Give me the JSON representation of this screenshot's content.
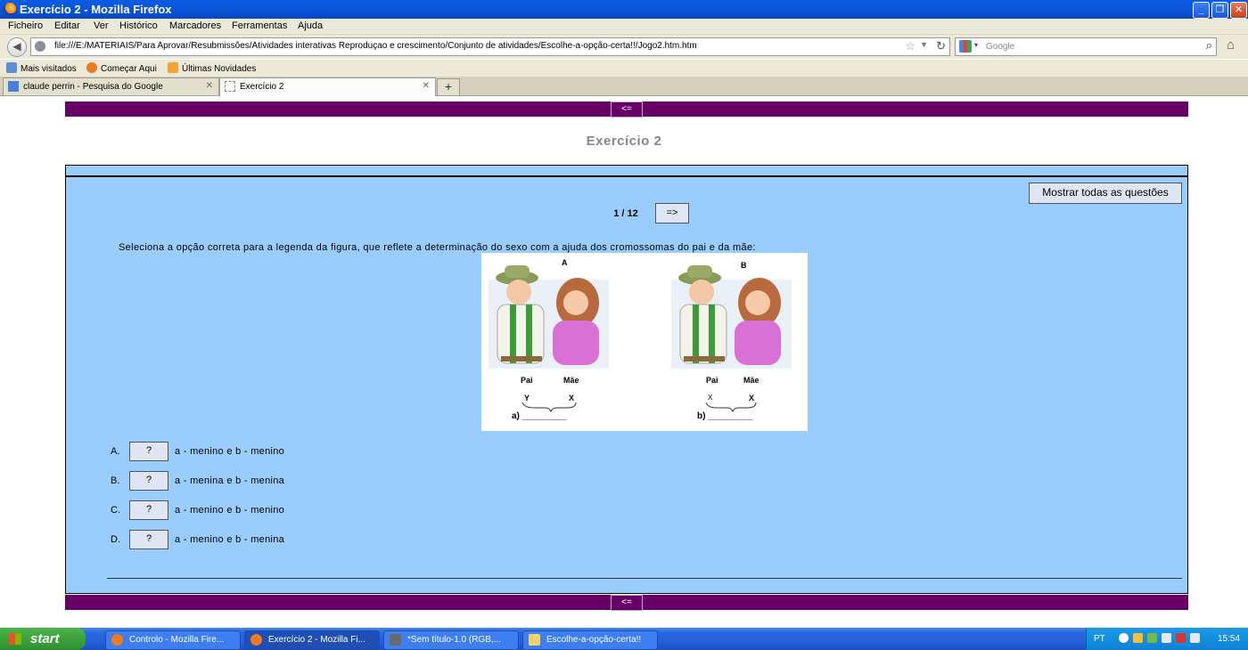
{
  "window": {
    "title": "Exercício 2 - Mozilla Firefox",
    "controls": [
      "minimize",
      "maximize",
      "close"
    ]
  },
  "menu": [
    "Ficheiro",
    "Editar",
    "Ver",
    "Histórico",
    "Marcadores",
    "Ferramentas",
    "Ajuda"
  ],
  "address": {
    "url": "file:///E:/MATERIAIS/Para Aprovar/Resubmissões/Atividades interativas Reproduçao e crescimento/Conjunto de atividades/Escolhe-a-opção-certa!!/Jogo2.htm.htm",
    "search_placeholder": "Google"
  },
  "bookmarks": [
    "Mais visitados",
    "Começar Aqui",
    "Últimas Novidades"
  ],
  "tabs": [
    {
      "label": "claude perrin - Pesquisa do Google",
      "active": false
    },
    {
      "label": "Exercício 2",
      "active": true
    }
  ],
  "page": {
    "nav_back_label": "<=",
    "title": "Exercício 2",
    "show_all_label": "Mostrar todas as questões",
    "counter": "1 / 12",
    "next_label": "=>",
    "question": "Seleciona a opção correta para a legenda da figura, que reflete a determinação do sexo com a ajuda dos cromossomas do pai e da mãe:",
    "figure": {
      "panel_a": {
        "tag": "A",
        "pai": "Pai",
        "mae": "Mãe",
        "chrom_pai": "Y",
        "chrom_mae": "X",
        "caption": "a) _________"
      },
      "panel_b": {
        "tag": "B",
        "pai": "Pai",
        "mae": "Mãe",
        "chrom_pai": "X",
        "chrom_mae": "X",
        "caption": "b) _________"
      }
    },
    "options": [
      {
        "letter": "A.",
        "button": "?",
        "text": "a - menino e b - menino"
      },
      {
        "letter": "B.",
        "button": "?",
        "text": "a - menina e b - menina"
      },
      {
        "letter": "C.",
        "button": "?",
        "text": "a - menino e b - menino"
      },
      {
        "letter": "D.",
        "button": "?",
        "text": "a - menino e b - menina"
      }
    ]
  },
  "taskbar": {
    "start_label": "start",
    "items": [
      {
        "label": "Controlo - Mozilla Fire...",
        "active": false
      },
      {
        "label": "Exercício 2 - Mozilla Fi...",
        "active": true
      },
      {
        "label": "*Sem título-1.0 (RGB,...",
        "active": false
      },
      {
        "label": "Escolhe-a-opção-certa!!",
        "active": false
      }
    ],
    "tray_lang": "PT",
    "clock": "15:54"
  },
  "colors": {
    "nav_strip": "#660066",
    "panel_bg": "#99ccff",
    "title_gray": "#888888",
    "button_bg": "#dde6f2"
  }
}
